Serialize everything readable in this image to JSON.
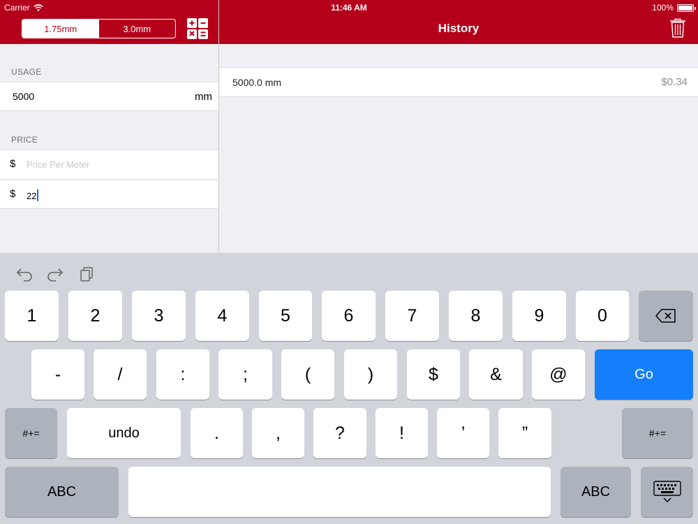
{
  "status": {
    "carrier": "Carrier",
    "time": "11:46 AM",
    "battery": "100%"
  },
  "header": {
    "segments": [
      "1.75mm",
      "3.0mm"
    ],
    "selected_segment": "1.75mm",
    "history_title": "History"
  },
  "usage": {
    "section_label": "USAGE",
    "value": "5000",
    "unit": "mm"
  },
  "price": {
    "section_label": "PRICE",
    "currency": "$",
    "per_meter_placeholder": "Price Per Meter",
    "second_value": "22"
  },
  "history": [
    {
      "length": "5000.0 mm",
      "cost": "$0.34"
    }
  ],
  "keyboard": {
    "row1": [
      "1",
      "2",
      "3",
      "4",
      "5",
      "6",
      "7",
      "8",
      "9",
      "0"
    ],
    "row2": [
      "-",
      "/",
      ":",
      ";",
      "(",
      ")",
      "$",
      "&",
      "@"
    ],
    "go": "Go",
    "row3": {
      "left": "#+=",
      "undo": "undo",
      "keys": [
        ".",
        ",",
        "?",
        "!",
        "’",
        "”"
      ],
      "right": "#+="
    },
    "row4": {
      "left": "ABC",
      "right": "ABC"
    }
  },
  "colors": {
    "brand": "#b4001a",
    "accent": "#157efb"
  }
}
